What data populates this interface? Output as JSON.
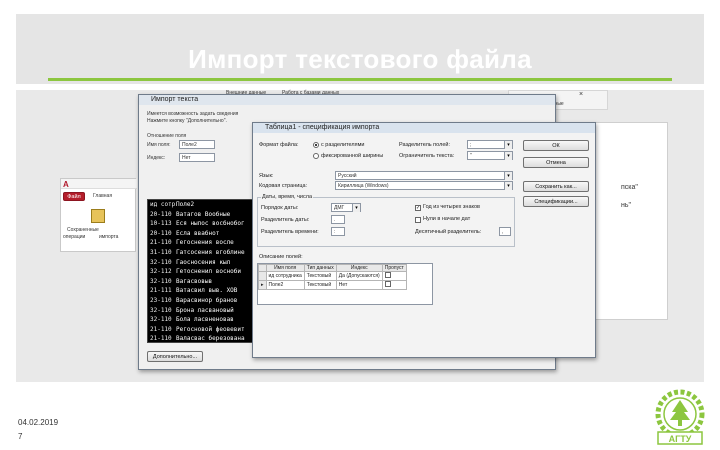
{
  "slide": {
    "title": "Импорт текстового файла",
    "date": "04.02.2019",
    "page": "7",
    "accent": "#8cc63f",
    "logo_text": "АГТУ"
  },
  "access_bg": {
    "tab_label": "Файл",
    "tab_label2": "Главная",
    "saved_label1": "Сохраненные",
    "saved_label2": "операции",
    "saved_label3": "импорта",
    "right_text1": "пска\"",
    "right_text2": "нь\"",
    "right_corner": "Клиенты  Гланые"
  },
  "wizard": {
    "title": "Импорт текста",
    "intro1": "Имеется возможность задать сведения",
    "intro2": "Нажмите кнопку \"Дополнительно\".",
    "field_label1": "Отношение поля",
    "row1_label": "Имя поля:",
    "row1_value": "Поле2",
    "row2_label": "Индекс:",
    "row2_value": "Нет",
    "lines": [
      [
        "ид сотр",
        "Поле2"
      ],
      [
        "20-110",
        "Ватагов Вообные"
      ],
      [
        "10-113",
        "Еся ныпос восбнобог"
      ],
      [
        "20-110",
        "Есла ввабнот"
      ],
      [
        "21-110",
        "Гегоснения восле"
      ],
      [
        "31-110",
        "Гатсосения вгоблине"
      ],
      [
        "32-110",
        "Гаосносения кыл"
      ],
      [
        "32-112",
        "Гетосненил восноби"
      ],
      [
        "32-110",
        "Вагасвовыв"
      ],
      [
        "21-111",
        "Ватасвил выв. ХОВ"
      ],
      [
        "23-110",
        "Варасвинор бранов"
      ],
      [
        "32-110",
        "Брона ласвановый"
      ],
      [
        "32-110",
        "Бола ласвненовав"
      ],
      [
        "21-110",
        "Регосновой феовевит"
      ],
      [
        "21-110",
        "Валасвас березована"
      ]
    ],
    "more_button": "Дополнительно..."
  },
  "spec": {
    "title": "Таблица1 - спецификация импорта",
    "format_label": "Формат файла:",
    "opt_delimited": "с разделителями",
    "opt_fixed": "фиксированной ширины",
    "field_sep_label": "Разделитель полей:",
    "field_sep_value": ";",
    "text_qual_label": "Ограничитель текста:",
    "text_qual_value": "\"",
    "lang_label": "Язык:",
    "lang_value": "Русский",
    "codepage_label": "Кодовая страница:",
    "codepage_value": "Кириллица (Windows)",
    "dates_group": "Даты, время, числа",
    "date_order_label": "Порядок даты:",
    "date_order_value": "ДМГ",
    "date_sep_label": "Разделитель даты:",
    "date_sep_value": ".",
    "time_sep_label": "Разделитель времени:",
    "time_sep_value": ":",
    "four_digit": "Год из четырех знаков",
    "leading_zeros": "Нули в начале дат",
    "decimal_label": "Десятичный разделитель:",
    "decimal_value": ",",
    "fields_label": "Описание полей:",
    "grid_headers": [
      "Имя поля",
      "Тип данных",
      "Индекс",
      "Пропуст"
    ],
    "grid_rows": [
      [
        "ид сотрудника",
        "Текстовый",
        "Да (Допускаются)",
        ""
      ],
      [
        "Поле2",
        "Текстовый",
        "Нет",
        ""
      ]
    ],
    "ok": "ОК",
    "cancel": "Отмена",
    "save_as": "Сохранить как...",
    "specs": "Спецификации..."
  },
  "back_win": {
    "title1": "Внешние данные",
    "title2": "Работа с базами данных",
    "close": "×"
  }
}
